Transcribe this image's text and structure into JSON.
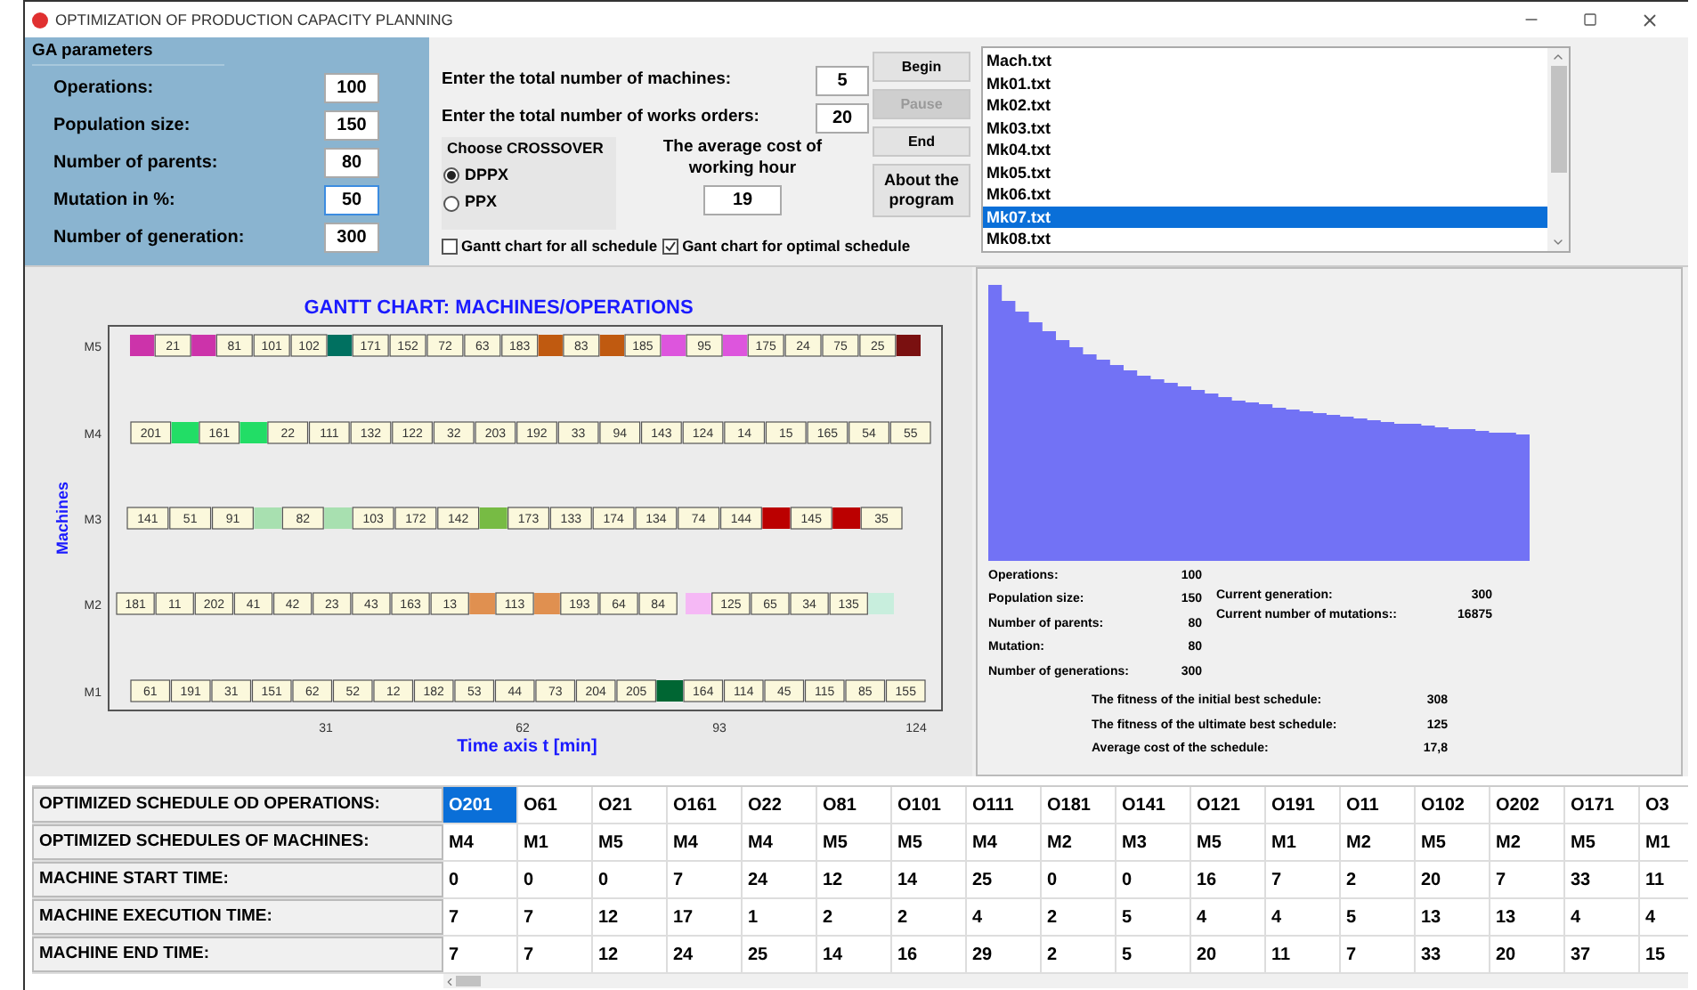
{
  "window": {
    "title": "OPTIMIZATION OF PRODUCTION CAPACITY PLANNING"
  },
  "ga_parameters": {
    "title": "GA parameters",
    "fields": [
      {
        "label": "Operations:",
        "value": "100",
        "focused": false
      },
      {
        "label": "Population size:",
        "value": "150",
        "focused": false
      },
      {
        "label": "Number of parents:",
        "value": "80",
        "focused": false
      },
      {
        "label": "Mutation in %:",
        "value": "50",
        "focused": true
      },
      {
        "label": "Number of generation:",
        "value": "300",
        "focused": false
      }
    ]
  },
  "machine_fields": [
    {
      "label": "Enter the total number of machines:",
      "value": "5"
    },
    {
      "label": "Enter the total number of works orders:",
      "value": "20"
    }
  ],
  "crossover": {
    "title": "Choose CROSSOVER",
    "options": [
      {
        "label": "DPPX",
        "selected": true
      },
      {
        "label": "PPX",
        "selected": false
      }
    ]
  },
  "cost": {
    "label": "The average cost of working hour",
    "value": "19"
  },
  "checkboxes": [
    {
      "label": "Gantt chart for all schedule",
      "checked": false
    },
    {
      "label": "Gant chart for optimal schedule",
      "checked": true
    }
  ],
  "buttons": [
    {
      "label": "Begin",
      "disabled": false
    },
    {
      "label": "Pause",
      "disabled": true
    },
    {
      "label": "End",
      "disabled": false
    },
    {
      "label": "About the program",
      "disabled": false
    }
  ],
  "files": [
    {
      "name": "Mach.txt",
      "selected": false
    },
    {
      "name": "Mk01.txt",
      "selected": false
    },
    {
      "name": "Mk02.txt",
      "selected": false
    },
    {
      "name": "Mk03.txt",
      "selected": false
    },
    {
      "name": "Mk04.txt",
      "selected": false
    },
    {
      "name": "Mk05.txt",
      "selected": false
    },
    {
      "name": "Mk06.txt",
      "selected": false
    },
    {
      "name": "Mk07.txt",
      "selected": true
    },
    {
      "name": "Mk08.txt",
      "selected": false
    }
  ],
  "gantt": {
    "title": "GANTT CHART: MACHINES/OPERATIONS",
    "ylabel": "Machines",
    "xlabel": "Time axis t [min]",
    "ticks": [
      "31",
      "62",
      "93",
      "124"
    ],
    "rows": [
      {
        "machine": "M5",
        "segments": [
          {
            "kind": "gap",
            "color": "#cc33aa"
          },
          {
            "kind": "op",
            "label": "21"
          },
          {
            "kind": "gap",
            "color": "#cc33aa"
          },
          {
            "kind": "op",
            "label": "81"
          },
          {
            "kind": "op",
            "label": "101"
          },
          {
            "kind": "op",
            "label": "102"
          },
          {
            "kind": "gap",
            "color": "#007060"
          },
          {
            "kind": "op",
            "label": "171"
          },
          {
            "kind": "op",
            "label": "152"
          },
          {
            "kind": "op",
            "label": "72"
          },
          {
            "kind": "op",
            "label": "63"
          },
          {
            "kind": "op",
            "label": "183"
          },
          {
            "kind": "gap",
            "color": "#c05a10"
          },
          {
            "kind": "op",
            "label": "83"
          },
          {
            "kind": "gap",
            "color": "#c05a10"
          },
          {
            "kind": "op",
            "label": "185"
          },
          {
            "kind": "gap",
            "color": "#dd55dd"
          },
          {
            "kind": "op",
            "label": "95"
          },
          {
            "kind": "gap",
            "color": "#dd55dd"
          },
          {
            "kind": "op",
            "label": "175"
          },
          {
            "kind": "op",
            "label": "24"
          },
          {
            "kind": "op",
            "label": "75"
          },
          {
            "kind": "op",
            "label": "25"
          },
          {
            "kind": "gap",
            "color": "#7a1010"
          }
        ]
      },
      {
        "machine": "M4",
        "segments": [
          {
            "kind": "op",
            "label": "201"
          },
          {
            "kind": "gap",
            "color": "#22dd66"
          },
          {
            "kind": "op",
            "label": "161"
          },
          {
            "kind": "gap",
            "color": "#22dd66"
          },
          {
            "kind": "op",
            "label": "22"
          },
          {
            "kind": "op",
            "label": "111"
          },
          {
            "kind": "op",
            "label": "132"
          },
          {
            "kind": "op",
            "label": "122"
          },
          {
            "kind": "op",
            "label": "32"
          },
          {
            "kind": "op",
            "label": "203"
          },
          {
            "kind": "op",
            "label": "192"
          },
          {
            "kind": "op",
            "label": "33"
          },
          {
            "kind": "op",
            "label": "94"
          },
          {
            "kind": "op",
            "label": "143"
          },
          {
            "kind": "op",
            "label": "124"
          },
          {
            "kind": "op",
            "label": "14"
          },
          {
            "kind": "op",
            "label": "15"
          },
          {
            "kind": "op",
            "label": "165"
          },
          {
            "kind": "op",
            "label": "54"
          },
          {
            "kind": "op",
            "label": "55"
          }
        ]
      },
      {
        "machine": "M3",
        "segments": [
          {
            "kind": "op",
            "label": "141"
          },
          {
            "kind": "op",
            "label": "51"
          },
          {
            "kind": "op",
            "label": "91"
          },
          {
            "kind": "gap",
            "color": "#a8e0b0"
          },
          {
            "kind": "op",
            "label": "82"
          },
          {
            "kind": "gap",
            "color": "#a8e0b0"
          },
          {
            "kind": "op",
            "label": "103"
          },
          {
            "kind": "op",
            "label": "172"
          },
          {
            "kind": "op",
            "label": "142"
          },
          {
            "kind": "gap",
            "color": "#77bb44"
          },
          {
            "kind": "op",
            "label": "173"
          },
          {
            "kind": "op",
            "label": "133"
          },
          {
            "kind": "op",
            "label": "174"
          },
          {
            "kind": "op",
            "label": "134"
          },
          {
            "kind": "op",
            "label": "74"
          },
          {
            "kind": "op",
            "label": "144"
          },
          {
            "kind": "gap",
            "color": "#bb0000"
          },
          {
            "kind": "op",
            "label": "145"
          },
          {
            "kind": "gap",
            "color": "#bb0000"
          },
          {
            "kind": "op",
            "label": "35"
          }
        ]
      },
      {
        "machine": "M2",
        "segments": [
          {
            "kind": "op",
            "label": "181"
          },
          {
            "kind": "op",
            "label": "11"
          },
          {
            "kind": "op",
            "label": "202"
          },
          {
            "kind": "op",
            "label": "41"
          },
          {
            "kind": "op",
            "label": "42"
          },
          {
            "kind": "op",
            "label": "23"
          },
          {
            "kind": "op",
            "label": "43"
          },
          {
            "kind": "op",
            "label": "163"
          },
          {
            "kind": "op",
            "label": "13"
          },
          {
            "kind": "gap",
            "color": "#e09050"
          },
          {
            "kind": "op",
            "label": "113"
          },
          {
            "kind": "gap",
            "color": "#e09050"
          },
          {
            "kind": "op",
            "label": "193"
          },
          {
            "kind": "op",
            "label": "64"
          },
          {
            "kind": "op",
            "label": "84"
          },
          {
            "kind": "idle"
          },
          {
            "kind": "gap",
            "color": "#f5b8f5"
          },
          {
            "kind": "op",
            "label": "125"
          },
          {
            "kind": "op",
            "label": "65"
          },
          {
            "kind": "op",
            "label": "34"
          },
          {
            "kind": "op",
            "label": "135"
          },
          {
            "kind": "gap",
            "color": "#c8eedd"
          }
        ]
      },
      {
        "machine": "M1",
        "segments": [
          {
            "kind": "op",
            "label": "61"
          },
          {
            "kind": "op",
            "label": "191"
          },
          {
            "kind": "op",
            "label": "31"
          },
          {
            "kind": "op",
            "label": "151"
          },
          {
            "kind": "op",
            "label": "62"
          },
          {
            "kind": "op",
            "label": "52"
          },
          {
            "kind": "op",
            "label": "12"
          },
          {
            "kind": "op",
            "label": "182"
          },
          {
            "kind": "op",
            "label": "53"
          },
          {
            "kind": "op",
            "label": "44"
          },
          {
            "kind": "op",
            "label": "73"
          },
          {
            "kind": "op",
            "label": "204"
          },
          {
            "kind": "op",
            "label": "205"
          },
          {
            "kind": "gap",
            "color": "#006633"
          },
          {
            "kind": "op",
            "label": "164"
          },
          {
            "kind": "op",
            "label": "114"
          },
          {
            "kind": "op",
            "label": "45"
          },
          {
            "kind": "op",
            "label": "115"
          },
          {
            "kind": "op",
            "label": "85"
          },
          {
            "kind": "op",
            "label": "155"
          }
        ]
      }
    ]
  },
  "stats": {
    "left": [
      {
        "label": "Operations:",
        "value": "100"
      },
      {
        "label": "Population size:",
        "value": "150"
      },
      {
        "label": "Number of parents:",
        "value": "80"
      },
      {
        "label": "Mutation:",
        "value": "80"
      },
      {
        "label": "Number of generations:",
        "value": "300"
      }
    ],
    "right": [
      {
        "label": "Current generation:",
        "value": "300"
      },
      {
        "label": "Current number of mutations::",
        "value": "16875"
      }
    ],
    "summary": [
      {
        "label": "The fitness of the initial best schedule:",
        "value": "308"
      },
      {
        "label": "The fitness of the ultimate best schedule:",
        "value": "125"
      },
      {
        "label": "Average cost of the schedule:",
        "value": "17,8"
      }
    ]
  },
  "table": {
    "rows": [
      {
        "header": "OPTIMIZED SCHEDULE OD OPERATIONS:",
        "cells": [
          {
            "text": "O201",
            "selected": true
          },
          {
            "text": "O61",
            "selected": false
          },
          {
            "text": "O21",
            "selected": false
          },
          {
            "text": "O161",
            "selected": false
          },
          {
            "text": "O22",
            "selected": false
          },
          {
            "text": "O81",
            "selected": false
          },
          {
            "text": "O101",
            "selected": false
          },
          {
            "text": "O111",
            "selected": false
          },
          {
            "text": "O181",
            "selected": false
          },
          {
            "text": "O141",
            "selected": false
          },
          {
            "text": "O121",
            "selected": false
          },
          {
            "text": "O191",
            "selected": false
          },
          {
            "text": "O11",
            "selected": false
          },
          {
            "text": "O102",
            "selected": false
          },
          {
            "text": "O202",
            "selected": false
          },
          {
            "text": "O171",
            "selected": false
          },
          {
            "text": "O3",
            "selected": false
          }
        ]
      },
      {
        "header": "OPTIMIZED SCHEDULES OF MACHINES:",
        "cells": [
          {
            "text": "M4",
            "selected": false
          },
          {
            "text": "M1",
            "selected": false
          },
          {
            "text": "M5",
            "selected": false
          },
          {
            "text": "M4",
            "selected": false
          },
          {
            "text": "M4",
            "selected": false
          },
          {
            "text": "M5",
            "selected": false
          },
          {
            "text": "M5",
            "selected": false
          },
          {
            "text": "M4",
            "selected": false
          },
          {
            "text": "M2",
            "selected": false
          },
          {
            "text": "M3",
            "selected": false
          },
          {
            "text": "M5",
            "selected": false
          },
          {
            "text": "M1",
            "selected": false
          },
          {
            "text": "M2",
            "selected": false
          },
          {
            "text": "M5",
            "selected": false
          },
          {
            "text": "M2",
            "selected": false
          },
          {
            "text": "M5",
            "selected": false
          },
          {
            "text": "M1",
            "selected": false
          }
        ]
      },
      {
        "header": "MACHINE START TIME:",
        "cells": [
          {
            "text": "0",
            "selected": false
          },
          {
            "text": "0",
            "selected": false
          },
          {
            "text": "0",
            "selected": false
          },
          {
            "text": "7",
            "selected": false
          },
          {
            "text": "24",
            "selected": false
          },
          {
            "text": "12",
            "selected": false
          },
          {
            "text": "14",
            "selected": false
          },
          {
            "text": "25",
            "selected": false
          },
          {
            "text": "0",
            "selected": false
          },
          {
            "text": "0",
            "selected": false
          },
          {
            "text": "16",
            "selected": false
          },
          {
            "text": "7",
            "selected": false
          },
          {
            "text": "2",
            "selected": false
          },
          {
            "text": "20",
            "selected": false
          },
          {
            "text": "7",
            "selected": false
          },
          {
            "text": "33",
            "selected": false
          },
          {
            "text": "11",
            "selected": false
          }
        ]
      },
      {
        "header": "MACHINE EXECUTION TIME:",
        "cells": [
          {
            "text": "7",
            "selected": false
          },
          {
            "text": "7",
            "selected": false
          },
          {
            "text": "12",
            "selected": false
          },
          {
            "text": "17",
            "selected": false
          },
          {
            "text": "1",
            "selected": false
          },
          {
            "text": "2",
            "selected": false
          },
          {
            "text": "2",
            "selected": false
          },
          {
            "text": "4",
            "selected": false
          },
          {
            "text": "2",
            "selected": false
          },
          {
            "text": "5",
            "selected": false
          },
          {
            "text": "4",
            "selected": false
          },
          {
            "text": "4",
            "selected": false
          },
          {
            "text": "5",
            "selected": false
          },
          {
            "text": "13",
            "selected": false
          },
          {
            "text": "13",
            "selected": false
          },
          {
            "text": "4",
            "selected": false
          },
          {
            "text": "4",
            "selected": false
          }
        ]
      },
      {
        "header": "MACHINE END TIME:",
        "cells": [
          {
            "text": "7",
            "selected": false
          },
          {
            "text": "7",
            "selected": false
          },
          {
            "text": "12",
            "selected": false
          },
          {
            "text": "24",
            "selected": false
          },
          {
            "text": "25",
            "selected": false
          },
          {
            "text": "14",
            "selected": false
          },
          {
            "text": "16",
            "selected": false
          },
          {
            "text": "29",
            "selected": false
          },
          {
            "text": "2",
            "selected": false
          },
          {
            "text": "5",
            "selected": false
          },
          {
            "text": "20",
            "selected": false
          },
          {
            "text": "11",
            "selected": false
          },
          {
            "text": "7",
            "selected": false
          },
          {
            "text": "33",
            "selected": false
          },
          {
            "text": "20",
            "selected": false
          },
          {
            "text": "37",
            "selected": false
          },
          {
            "text": "15",
            "selected": false
          }
        ]
      }
    ]
  }
}
